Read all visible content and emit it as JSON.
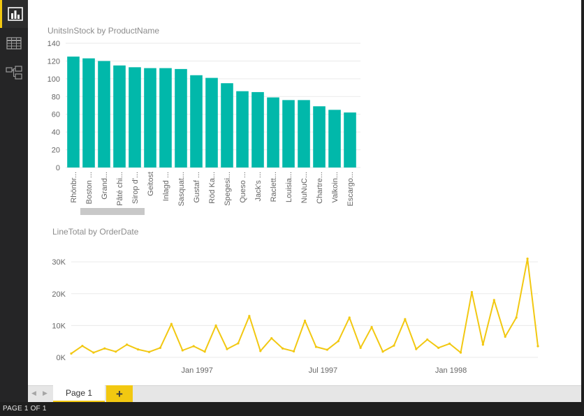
{
  "nav": {
    "items": [
      {
        "name": "report-view",
        "icon": "bar-chart-icon",
        "active": true
      },
      {
        "name": "data-view",
        "icon": "table-grid-icon",
        "active": false
      },
      {
        "name": "relationships-view",
        "icon": "relationships-icon",
        "active": false
      }
    ]
  },
  "colors": {
    "bar": "#01b8aa",
    "line": "#f2c811",
    "gridline": "#eaeaea",
    "accent": "#f2c811"
  },
  "chart_data": [
    {
      "type": "bar",
      "title": "UnitsInStock by ProductName",
      "categories": [
        "Rhönbr...",
        "Boston ...",
        "Grand...",
        "Pâté chi...",
        "Sirop d'...",
        "Geitost",
        "Inlagd ...",
        "Sasquat...",
        "Gustaf ...",
        "Röd Ka...",
        "Spegesi...",
        "Queso ...",
        "Jack's ...",
        "Raclett...",
        "Louisia...",
        "NuNuC...",
        "Chartre...",
        "Valkoin...",
        "Escargo..."
      ],
      "values": [
        125,
        123,
        120,
        115,
        113,
        112,
        112,
        111,
        104,
        101,
        95,
        86,
        85,
        79,
        76,
        76,
        69,
        65,
        62
      ],
      "ylim": [
        0,
        140
      ],
      "yticks": [
        "0",
        "20",
        "40",
        "60",
        "80",
        "100",
        "120",
        "140"
      ],
      "grid": true,
      "scrollbar": true
    },
    {
      "type": "line",
      "title": "LineTotal by OrderDate",
      "xlim": [
        "1996-07-04",
        "1998-05-06"
      ],
      "xticks": [
        {
          "date": "1997-01-01",
          "label": "Jan 1997"
        },
        {
          "date": "1997-07-01",
          "label": "Jul 1997"
        },
        {
          "date": "1998-01-01",
          "label": "Jan 1998"
        }
      ],
      "ylim": [
        0,
        32000
      ],
      "yticks": [
        {
          "value": 0,
          "label": "0K"
        },
        {
          "value": 10000,
          "label": "10K"
        },
        {
          "value": 20000,
          "label": "20K"
        },
        {
          "value": 30000,
          "label": "30K"
        }
      ],
      "grid": true,
      "x": [
        "1996-07-04",
        "1996-07-20",
        "1996-08-05",
        "1996-08-21",
        "1996-09-06",
        "1996-09-22",
        "1996-10-08",
        "1996-10-24",
        "1996-11-09",
        "1996-11-25",
        "1996-12-11",
        "1996-12-27",
        "1997-01-12",
        "1997-01-28",
        "1997-02-13",
        "1997-03-01",
        "1997-03-17",
        "1997-04-02",
        "1997-04-18",
        "1997-05-04",
        "1997-05-20",
        "1997-06-05",
        "1997-06-21",
        "1997-07-07",
        "1997-07-23",
        "1997-08-08",
        "1997-08-24",
        "1997-09-09",
        "1997-09-25",
        "1997-10-11",
        "1997-10-27",
        "1997-11-12",
        "1997-11-28",
        "1997-12-14",
        "1997-12-30",
        "1998-01-15",
        "1998-01-31",
        "1998-02-16",
        "1998-03-04",
        "1998-03-20",
        "1998-04-05",
        "1998-04-21",
        "1998-05-06"
      ],
      "values": [
        1200,
        3600,
        1500,
        2800,
        1800,
        4000,
        2500,
        1700,
        3000,
        10500,
        2200,
        3500,
        1800,
        10000,
        2600,
        4400,
        13000,
        2000,
        6000,
        2800,
        1900,
        11500,
        3300,
        2400,
        5100,
        12500,
        3000,
        9500,
        1800,
        3700,
        12000,
        2600,
        5600,
        3000,
        4300,
        1500,
        20500,
        4000,
        18000,
        6500,
        12500,
        31000,
        3500
      ]
    }
  ],
  "tabs": {
    "prev_arrow": "◀",
    "next_arrow": "▶",
    "items": [
      {
        "label": "Page 1",
        "active": true
      }
    ],
    "add_label": "+"
  },
  "status": {
    "page_indicator": "PAGE 1 OF 1"
  }
}
